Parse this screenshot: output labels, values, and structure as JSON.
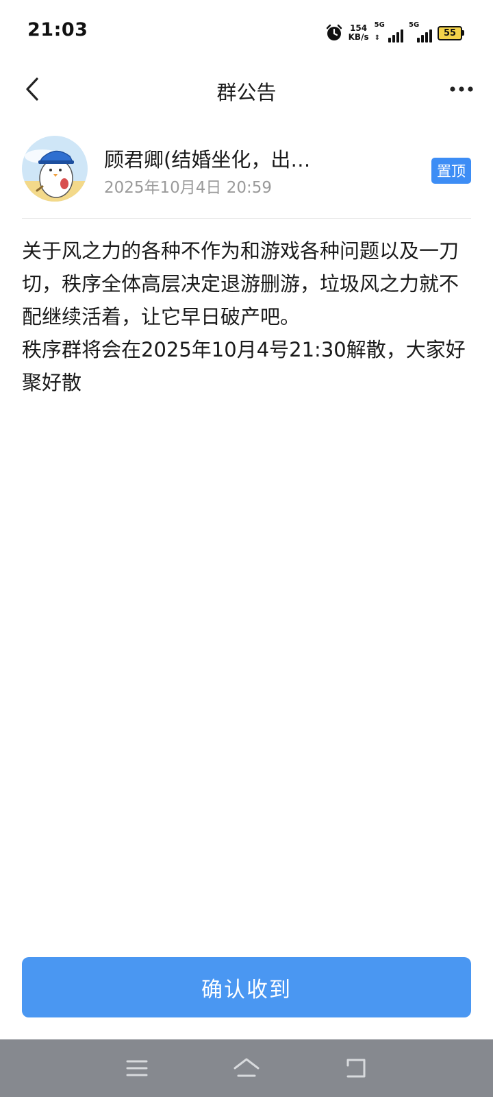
{
  "status_bar": {
    "time": "21:03",
    "net_speed_value": "154",
    "net_speed_unit": "KB/s",
    "sim1_label": "5G",
    "sim2_label": "5G",
    "battery": "55",
    "icons": [
      "alarm-icon",
      "signal-icon",
      "battery-icon"
    ]
  },
  "header": {
    "title": "群公告",
    "back_icon": "chevron-left-icon",
    "more_icon": "more-dots-icon"
  },
  "author": {
    "name": "顾君卿(结婚坐化，出…",
    "time": "2025年10月4日 20:59",
    "pin_label": "置顶"
  },
  "announcement": {
    "paragraphs": [
      "关于风之力的各种不作为和游戏各种问题以及一刀切，秩序全体高层决定退游删游，垃圾风之力就不配继续活着，让它早日破产吧。",
      "秩序群将会在2025年10月4号21:30解散，大家好聚好散"
    ]
  },
  "confirm_button": {
    "label": "确认收到"
  },
  "nav_bar": {
    "icons": [
      "menu-icon",
      "home-icon",
      "back-icon"
    ]
  },
  "colors": {
    "accent": "#3d8df5",
    "button": "#4a97f2",
    "nav_bar": "#86898f",
    "battery_fill": "#f4d34a"
  }
}
